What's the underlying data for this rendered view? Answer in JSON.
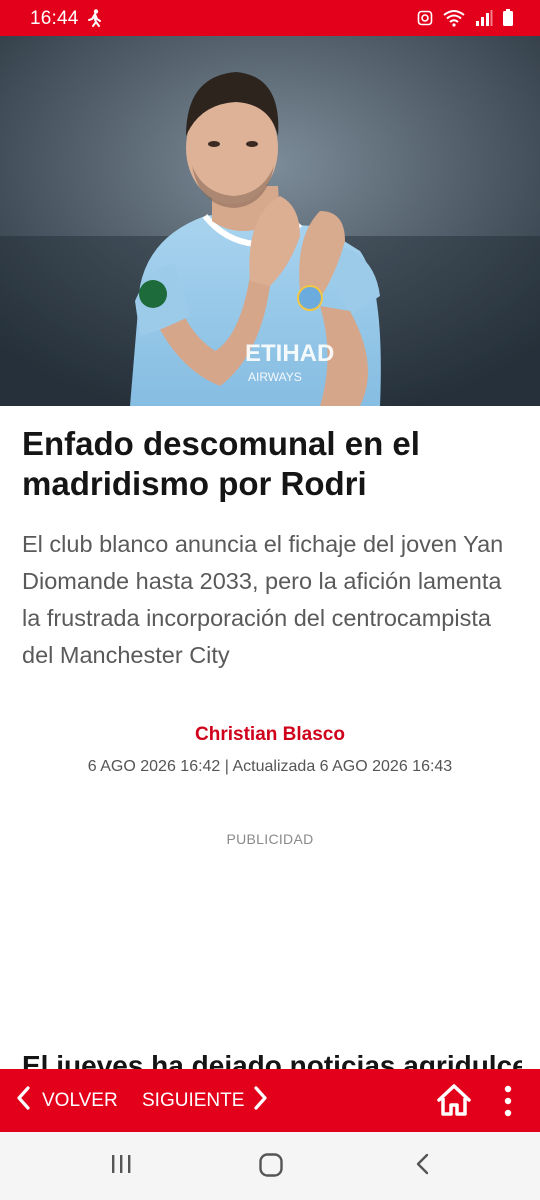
{
  "status_bar": {
    "time": "16:44",
    "icons": [
      "walking-icon",
      "data-saver-icon",
      "wifi-icon",
      "signal-icon",
      "battery-icon"
    ],
    "color": "#e3001b"
  },
  "hero": {
    "image_subject": "player-applauding-photo"
  },
  "article": {
    "headline": "Enfado descomunal en el madridismo por Rodri",
    "subtitle": "El club blanco anuncia el fichaje del joven Yan Diomande hasta 2033, pero la afición lamenta la frustrada incorporación del centrocampista del Manchester City",
    "author": "Christian Blasco",
    "dates": "6 AGO 2026 16:42 | Actualizada  6 AGO 2026 16:43",
    "ad_label": "PUBLICIDAD",
    "next_text": "El jueves ha dejado noticias agridulces"
  },
  "bottom_bar": {
    "back_label": "VOLVER",
    "next_label": "SIGUIENTE",
    "home_icon": "home-icon",
    "more_icon": "more-vertical-icon"
  },
  "android_nav": {
    "icons": [
      "recents-icon",
      "home-circle-icon",
      "back-chevron-icon"
    ]
  },
  "colors": {
    "brand_red": "#e3001b",
    "author_red": "#d0021b"
  }
}
